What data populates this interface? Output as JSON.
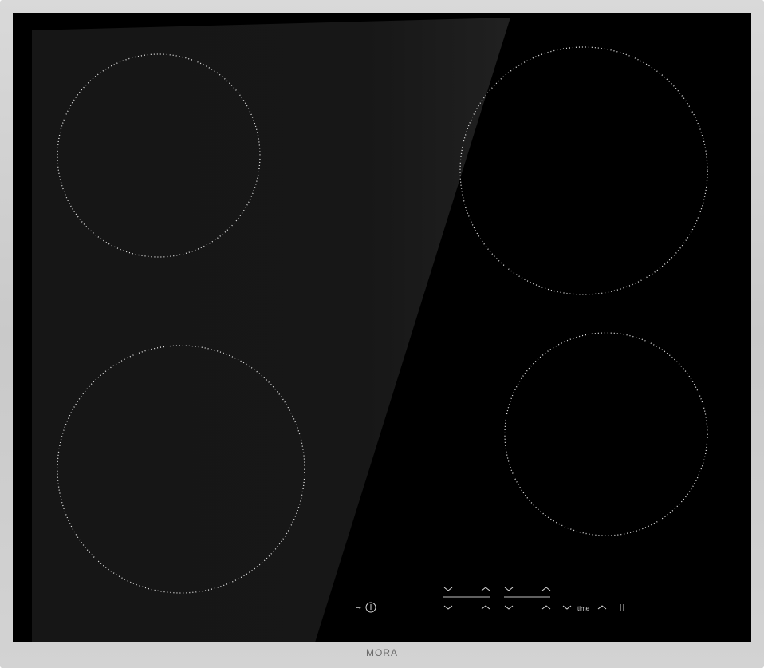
{
  "brand": {
    "logo_text": "MORA"
  },
  "controls": {
    "power_icon": "power-icon",
    "lock_icon": "lock-icon",
    "zone_selectors": [
      {
        "name": "zone-1",
        "up_icon": "chevron-up-icon",
        "down_icon": "chevron-down-icon"
      },
      {
        "name": "zone-2",
        "up_icon": "chevron-up-icon",
        "down_icon": "chevron-down-icon"
      },
      {
        "name": "zone-3",
        "up_icon": "chevron-up-icon",
        "down_icon": "chevron-down-icon"
      },
      {
        "name": "zone-4",
        "up_icon": "chevron-up-icon",
        "down_icon": "chevron-down-icon"
      }
    ],
    "timer_label": "time",
    "pause_icon": "pause-icon"
  },
  "colors": {
    "frame": "#cfcfcf",
    "glass": "#000000",
    "zone_dots": "#e6e6e6"
  }
}
